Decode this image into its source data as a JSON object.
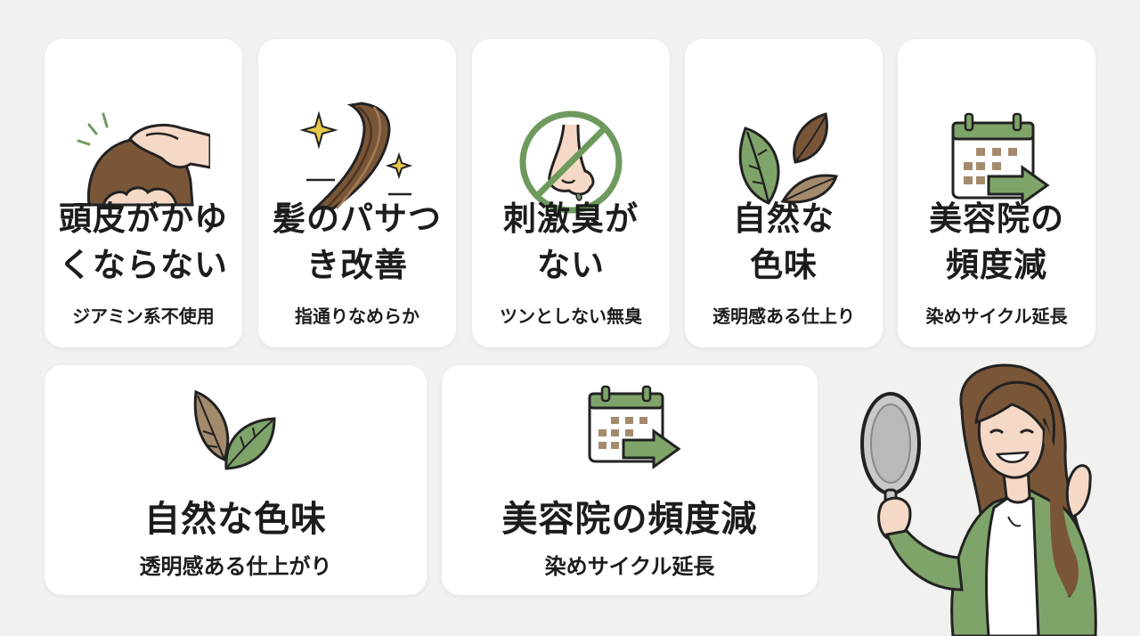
{
  "cards": [
    {
      "title": "頭皮がかゆ\nくならない",
      "subtitle": "ジアミン系不使用",
      "icon": "scalp-hand-icon"
    },
    {
      "title": "髪のパサつ\nき改善",
      "subtitle": "指通りなめらか",
      "icon": "shiny-hair-icon"
    },
    {
      "title": "刺激臭が\nない",
      "subtitle": "ツンとしない無臭",
      "icon": "no-smell-nose-icon"
    },
    {
      "title": "自然な\n色味",
      "subtitle": "透明感ある仕上り",
      "icon": "leaves-icon"
    },
    {
      "title": "美容院の\n頻度減",
      "subtitle": "染めサイクル延長",
      "icon": "calendar-arrow-icon"
    }
  ],
  "large_cards": [
    {
      "title": "自然な色味",
      "subtitle": "透明感ある仕上がり",
      "icon": "leaves-icon"
    },
    {
      "title": "美容院の頻度減",
      "subtitle": "染めサイクル延長",
      "icon": "calendar-arrow-icon"
    }
  ],
  "illustration": {
    "icon": "woman-with-hand-mirror-icon"
  },
  "colors": {
    "background": "#f1f1f0",
    "card": "#ffffff",
    "accent_green": "#6e9a5e",
    "hair_brown": "#7a5638",
    "leaf_tan": "#a48a6c",
    "text": "#1c1c1c"
  }
}
